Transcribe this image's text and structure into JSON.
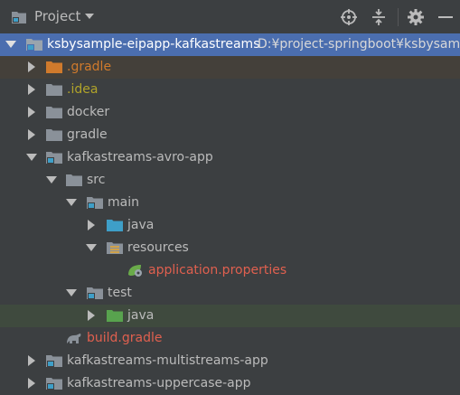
{
  "header": {
    "title": "Project",
    "buttons": [
      "locate-icon",
      "collapse-icon",
      "gear-icon",
      "minimize-icon"
    ]
  },
  "tree": {
    "root_name": "ksbysample-eipapp-kafkastreams",
    "root_path": "D:¥project-springboot¥ksbysample",
    "items": [
      {
        "label": ".gradle"
      },
      {
        "label": ".idea"
      },
      {
        "label": "docker"
      },
      {
        "label": "gradle"
      },
      {
        "label": "kafkastreams-avro-app"
      },
      {
        "label": "src"
      },
      {
        "label": "main"
      },
      {
        "label": "java"
      },
      {
        "label": "resources"
      },
      {
        "label": "application.properties"
      },
      {
        "label": "test"
      },
      {
        "label": "java"
      },
      {
        "label": "build.gradle"
      },
      {
        "label": "kafkastreams-multistreams-app"
      },
      {
        "label": "kafkastreams-uppercase-app"
      }
    ]
  },
  "colors": {
    "background": "#3c3f41",
    "selection": "#4b6eaf",
    "excluded_folder": "#d07a2c",
    "ignored_text": "#b0a32a",
    "unversioned_text": "#e0604f",
    "source_folder": "#3e9fc8",
    "test_folder": "#58a34e"
  }
}
